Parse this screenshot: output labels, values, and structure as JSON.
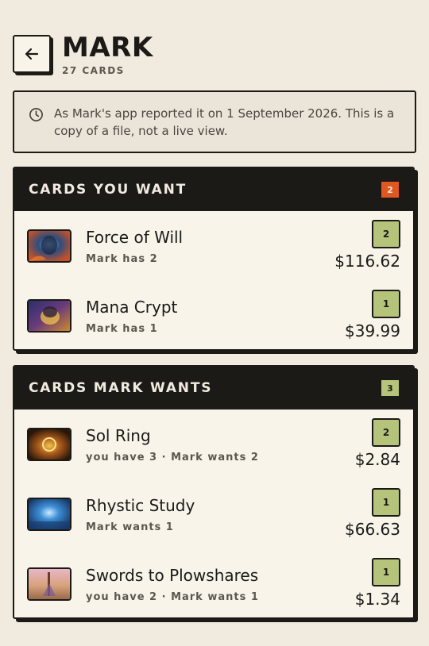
{
  "header": {
    "back_icon": "arrow-left-icon",
    "title": "MARK",
    "subtitle": "27 CARDS"
  },
  "notice": {
    "icon": "clock-icon",
    "text": "As Mark's app reported it on 1 September 2026. This is a copy of a file, not a live view."
  },
  "wanted": {
    "heading": "CARDS YOU WANT",
    "count": "2",
    "badge_color": "#e0571f",
    "items": [
      {
        "name": "Force of Will",
        "detail": "Mark has 2",
        "qty": "2",
        "price": "$116.62"
      },
      {
        "name": "Mana Crypt",
        "detail": "Mark has 1",
        "qty": "1",
        "price": "$39.99"
      }
    ]
  },
  "mark_wants": {
    "heading": "CARDS MARK WANTS",
    "count": "3",
    "badge_color": "#b5c47a",
    "items": [
      {
        "name": "Sol Ring",
        "detail": "you have 3 · Mark wants 2",
        "qty": "2",
        "price": "$2.84"
      },
      {
        "name": "Rhystic Study",
        "detail": "Mark wants 1",
        "qty": "1",
        "price": "$66.63"
      },
      {
        "name": "Swords to Plowshares",
        "detail": "you have 2 · Mark wants 1",
        "qty": "1",
        "price": "$1.34"
      }
    ]
  },
  "colors": {
    "ink": "#1b1a17",
    "paper": "#f1ebdf",
    "qty_green": "#b5c47a",
    "alert_orange": "#e0571f"
  }
}
